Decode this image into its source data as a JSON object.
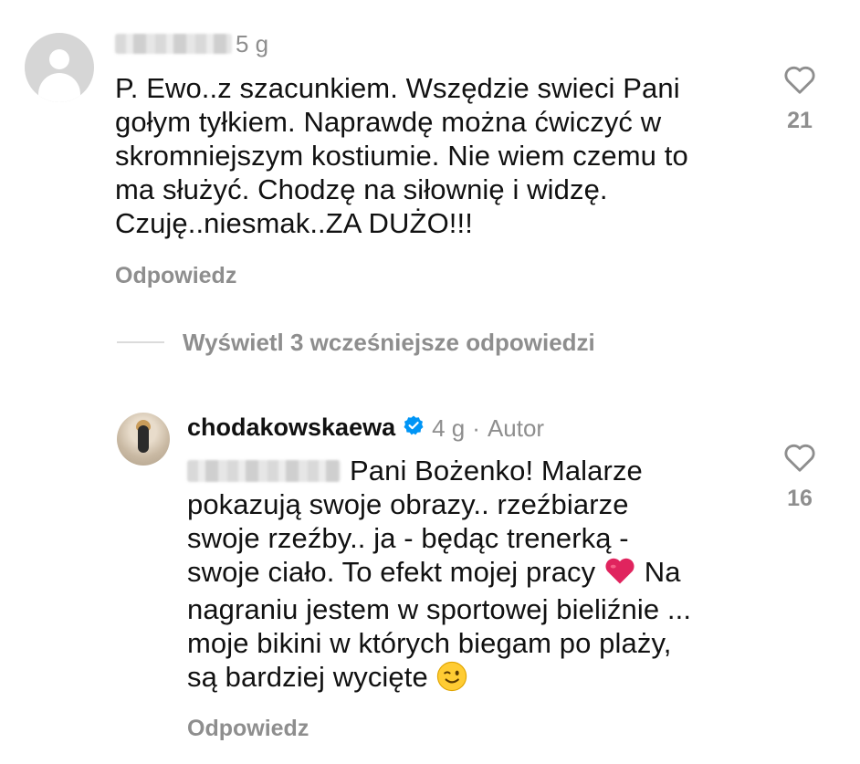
{
  "comment1": {
    "time": "5 g",
    "text_lines": [
      "P. Ewo..z szacunkiem. Wszędzie swieci Pani",
      "gołym tyłkiem. Naprawdę można ćwiczyć w",
      "skromniejszym kostiumie. Nie wiem czemu to",
      "ma służyć. Chodzę na siłownię i widzę.",
      "Czuję..niesmak..ZA DUŻO!!!"
    ],
    "reply_label": "Odpowiedz",
    "like_count": "21"
  },
  "view_replies": {
    "label": "Wyświetl 3 wcześniejsze odpowiedzi"
  },
  "comment2": {
    "username": "chodakowskaewa",
    "time": "4 g",
    "separator": "·",
    "author_badge": "Autor",
    "first_line_text": "Pani Bożenko! Malarze",
    "text_lines": [
      "pokazują swoje obrazy.. rzeźbiarze",
      "swoje rzeźby.. ja - będąc trenerką -"
    ],
    "line4_before": "swoje ciało. To efekt mojej pracy",
    "line4_after": "Na",
    "text_lines_after": [
      "nagraniu jestem w sportowej bieliźnie ...",
      "moje bikini w których biegam po plaży,"
    ],
    "last_line": "są bardziej wycięte",
    "reply_label": "Odpowiedz",
    "like_count": "16",
    "emojis": [
      "red-heart",
      "winking-face"
    ]
  },
  "colors": {
    "secondary_text": "#8e8e8e",
    "verified_blue": "#0095f6",
    "heart_red": "#e0245e"
  }
}
